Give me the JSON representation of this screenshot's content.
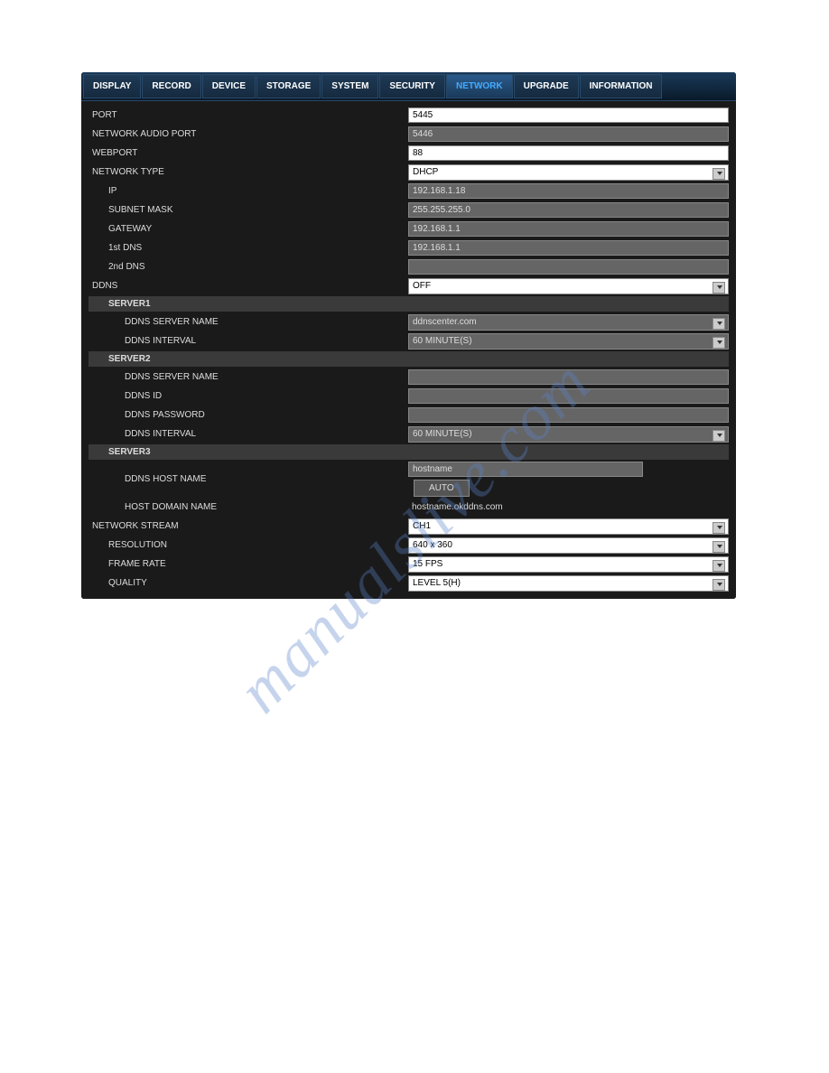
{
  "watermark": "manualslive.com",
  "tabs": [
    "DISPLAY",
    "RECORD",
    "DEVICE",
    "STORAGE",
    "SYSTEM",
    "SECURITY",
    "NETWORK",
    "UPGRADE",
    "INFORMATION"
  ],
  "active_tab": "NETWORK",
  "labels": {
    "port": "PORT",
    "network_audio_port": "NETWORK AUDIO PORT",
    "webport": "WEBPORT",
    "network_type": "NETWORK TYPE",
    "ip": "IP",
    "subnet_mask": "SUBNET MASK",
    "gateway": "GATEWAY",
    "first_dns": "1st DNS",
    "second_dns": "2nd DNS",
    "ddns": "DDNS",
    "server1": "SERVER1",
    "server2": "SERVER2",
    "server3": "SERVER3",
    "ddns_server_name": "DDNS SERVER NAME",
    "ddns_interval": "DDNS INTERVAL",
    "ddns_id": "DDNS ID",
    "ddns_password": "DDNS PASSWORD",
    "ddns_host_name": "DDNS HOST NAME",
    "host_domain_name": "HOST DOMAIN NAME",
    "network_stream": "NETWORK STREAM",
    "resolution": "RESOLUTION",
    "frame_rate": "FRAME RATE",
    "quality": "QUALITY",
    "auto": "AUTO"
  },
  "values": {
    "port": "5445",
    "network_audio_port": "5446",
    "webport": "88",
    "network_type": "DHCP",
    "ip": "192.168.1.18",
    "subnet_mask": "255.255.255.0",
    "gateway": "192.168.1.1",
    "first_dns": "192.168.1.1",
    "second_dns": "",
    "ddns": "OFF",
    "server1_name": "ddnscenter.com",
    "server1_interval": "60 MINUTE(S)",
    "server2_name": "",
    "server2_id": "",
    "server2_password": "",
    "server2_interval": "60 MINUTE(S)",
    "server3_hostname": "hostname",
    "host_domain": "hostname.okddns.com",
    "network_stream": "CH1",
    "resolution": "640 x 360",
    "frame_rate": "15 FPS",
    "quality": "LEVEL 5(H)"
  }
}
